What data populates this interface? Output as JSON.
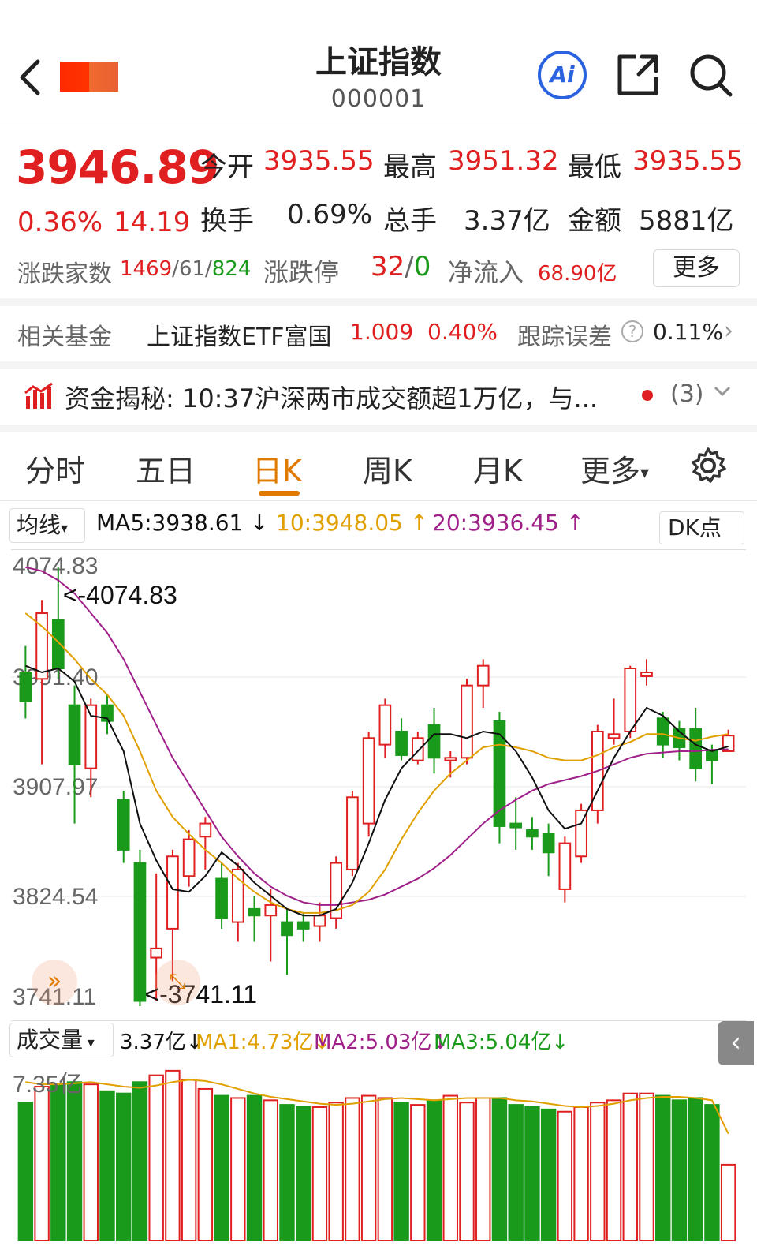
{
  "header": {
    "title": "上证指数",
    "code": "000001",
    "back_icon": "chevron-left-icon",
    "ai_label": "Ai",
    "share_icon": "share-icon",
    "search_icon": "search-icon"
  },
  "quote": {
    "price": "3946.89",
    "change_pct": "0.36%",
    "change_pts": "14.19",
    "open_label": "今开",
    "open": "3935.55",
    "high_label": "最高",
    "high": "3951.32",
    "low_label": "最低",
    "low": "3935.55",
    "turnover_label": "换手",
    "turnover": "0.69%",
    "volume_label": "总手",
    "volume": "3.37亿",
    "amount_label": "金额",
    "amount": "5881亿",
    "breadth_label": "涨跌家数",
    "breadth_up": "1469",
    "breadth_flat": "61",
    "breadth_down": "824",
    "limit_label": "涨跌停",
    "limit_up": "32",
    "limit_down": "0",
    "netflow_label": "净流入",
    "netflow": "68.90亿",
    "more_label": "更多"
  },
  "fund": {
    "label": "相关基金",
    "name": "上证指数ETF富国",
    "price": "1.009",
    "change": "0.40%",
    "tracking_label": "跟踪误差",
    "tracking": "0.11%"
  },
  "news": {
    "icon": "chart-icon",
    "text": "资金揭秘: 10:37沪深两市成交额超1万亿，与...",
    "count": "(3)"
  },
  "tabs": [
    "分时",
    "五日",
    "日K",
    "周K",
    "月K",
    "更多"
  ],
  "ma_bar": {
    "selector": "均线",
    "ma5": "MA5:3938.61",
    "ma10": "10:3948.05",
    "ma20": "20:3936.45",
    "dk_label": "DK点"
  },
  "vol_bar": {
    "selector": "成交量",
    "vol": "3.37亿",
    "ma1": "MA1:4.73亿",
    "ma2": "MA2:5.03亿",
    "ma3": "MA3:5.04亿"
  },
  "colors": {
    "up": "#e02020",
    "down": "#1a9a1a",
    "ma5": "#111111",
    "ma10": "#e0a000",
    "ma20": "#a0208a",
    "accent": "#e07a00"
  },
  "chart_data": {
    "type": "candlestick",
    "y_ticks": [
      "4074.83",
      "3991.40",
      "3907.97",
      "3824.54",
      "3741.11"
    ],
    "ylim": [
      3741.11,
      4074.83
    ],
    "high_label": "<-4074.83",
    "low_label": "<-3741.11",
    "candles": [
      {
        "o": 3995,
        "c": 3973,
        "h": 4015,
        "l": 3960
      },
      {
        "o": 3990,
        "c": 4040,
        "h": 4050,
        "l": 3925
      },
      {
        "o": 4035,
        "c": 3998,
        "h": 4074.83,
        "l": 3990
      },
      {
        "o": 3970,
        "c": 3925,
        "h": 3985,
        "l": 3880
      },
      {
        "o": 3922,
        "c": 3970,
        "h": 3975,
        "l": 3900
      },
      {
        "o": 3970,
        "c": 3958,
        "h": 3978,
        "l": 3948
      },
      {
        "o": 3898,
        "c": 3860,
        "h": 3905,
        "l": 3850
      },
      {
        "o": 3850,
        "c": 3745,
        "h": 3860,
        "l": 3741.11
      },
      {
        "o": 3778,
        "c": 3785,
        "h": 3842,
        "l": 3745
      },
      {
        "o": 3800,
        "c": 3855,
        "h": 3860,
        "l": 3760
      },
      {
        "o": 3840,
        "c": 3868,
        "h": 3875,
        "l": 3832
      },
      {
        "o": 3870,
        "c": 3880,
        "h": 3885,
        "l": 3845
      },
      {
        "o": 3838,
        "c": 3808,
        "h": 3850,
        "l": 3800
      },
      {
        "o": 3805,
        "c": 3845,
        "h": 3850,
        "l": 3790
      },
      {
        "o": 3815,
        "c": 3810,
        "h": 3825,
        "l": 3790
      },
      {
        "o": 3810,
        "c": 3818,
        "h": 3830,
        "l": 3775
      },
      {
        "o": 3805,
        "c": 3795,
        "h": 3815,
        "l": 3765
      },
      {
        "o": 3805,
        "c": 3800,
        "h": 3812,
        "l": 3790
      },
      {
        "o": 3802,
        "c": 3810,
        "h": 3820,
        "l": 3790
      },
      {
        "o": 3808,
        "c": 3850,
        "h": 3855,
        "l": 3800
      },
      {
        "o": 3845,
        "c": 3900,
        "h": 3905,
        "l": 3840
      },
      {
        "o": 3880,
        "c": 3945,
        "h": 3950,
        "l": 3870
      },
      {
        "o": 3940,
        "c": 3970,
        "h": 3975,
        "l": 3930
      },
      {
        "o": 3950,
        "c": 3932,
        "h": 3960,
        "l": 3928
      },
      {
        "o": 3928,
        "c": 3945,
        "h": 3950,
        "l": 3925
      },
      {
        "o": 3955,
        "c": 3930,
        "h": 3968,
        "l": 3918
      },
      {
        "o": 3928,
        "c": 3930,
        "h": 3935,
        "l": 3915
      },
      {
        "o": 3930,
        "c": 3985,
        "h": 3990,
        "l": 3925
      },
      {
        "o": 3985,
        "c": 4000,
        "h": 4005,
        "l": 3968
      },
      {
        "o": 3958,
        "c": 3878,
        "h": 3965,
        "l": 3865
      },
      {
        "o": 3880,
        "c": 3877,
        "h": 3900,
        "l": 3860
      },
      {
        "o": 3875,
        "c": 3870,
        "h": 3885,
        "l": 3860
      },
      {
        "o": 3872,
        "c": 3858,
        "h": 3880,
        "l": 3840
      },
      {
        "o": 3830,
        "c": 3865,
        "h": 3870,
        "l": 3820
      },
      {
        "o": 3855,
        "c": 3890,
        "h": 3895,
        "l": 3850
      },
      {
        "o": 3890,
        "c": 3950,
        "h": 3955,
        "l": 3880
      },
      {
        "o": 3945,
        "c": 3948,
        "h": 3975,
        "l": 3940
      },
      {
        "o": 3950,
        "c": 3998,
        "h": 4000,
        "l": 3945
      },
      {
        "o": 3992,
        "c": 3995,
        "h": 4005,
        "l": 3985
      },
      {
        "o": 3960,
        "c": 3940,
        "h": 3965,
        "l": 3930
      },
      {
        "o": 3952,
        "c": 3938,
        "h": 3958,
        "l": 3928
      },
      {
        "o": 3952,
        "c": 3922,
        "h": 3968,
        "l": 3912
      },
      {
        "o": 3935,
        "c": 3928,
        "h": 3940,
        "l": 3910
      },
      {
        "o": 3935,
        "c": 3946.89,
        "h": 3951.32,
        "l": 3935.55
      }
    ],
    "ma5": [
      4000,
      3995,
      3998,
      3988,
      3962,
      3960,
      3935,
      3880,
      3852,
      3830,
      3828,
      3840,
      3858,
      3848,
      3835,
      3825,
      3815,
      3810,
      3810,
      3815,
      3835,
      3865,
      3898,
      3922,
      3935,
      3948,
      3948,
      3945,
      3950,
      3948,
      3935,
      3915,
      3890,
      3876,
      3880,
      3905,
      3930,
      3950,
      3968,
      3962,
      3950,
      3940,
      3935,
      3938.61
    ],
    "ma10": [
      4040,
      4030,
      4018,
      4005,
      3990,
      3978,
      3962,
      3935,
      3905,
      3885,
      3872,
      3860,
      3850,
      3838,
      3828,
      3820,
      3815,
      3812,
      3812,
      3814,
      3818,
      3828,
      3845,
      3868,
      3888,
      3905,
      3918,
      3928,
      3938,
      3940,
      3938,
      3935,
      3930,
      3928,
      3928,
      3932,
      3938,
      3942,
      3948,
      3948,
      3945,
      3943,
      3946,
      3948.05
    ],
    "ma20": [
      4075,
      4072,
      4065,
      4055,
      4040,
      4025,
      4005,
      3980,
      3955,
      3930,
      3910,
      3890,
      3870,
      3855,
      3842,
      3832,
      3825,
      3820,
      3818,
      3818,
      3820,
      3822,
      3826,
      3832,
      3838,
      3846,
      3856,
      3868,
      3880,
      3890,
      3898,
      3905,
      3910,
      3913,
      3916,
      3920,
      3925,
      3930,
      3933,
      3934,
      3935,
      3935,
      3936,
      3936.45
    ],
    "volume": {
      "ytick": "7.35亿",
      "ymax": 7.6,
      "values": [
        6.1,
        6.8,
        6.9,
        7.0,
        6.9,
        6.6,
        6.5,
        7.0,
        7.3,
        7.5,
        7.1,
        6.7,
        6.4,
        6.3,
        6.4,
        6.2,
        6.0,
        5.9,
        5.9,
        6.1,
        6.3,
        6.4,
        6.3,
        6.1,
        6.0,
        6.2,
        6.4,
        6.1,
        6.3,
        6.3,
        6.0,
        5.9,
        5.8,
        5.7,
        5.9,
        6.1,
        6.2,
        6.5,
        6.5,
        6.4,
        6.2,
        6.3,
        6.0,
        3.37
      ],
      "ma1": [
        7.0,
        6.9,
        6.9,
        6.95,
        7.0,
        6.9,
        6.8,
        6.75,
        6.85,
        7.0,
        7.1,
        7.05,
        6.9,
        6.7,
        6.5,
        6.35,
        6.25,
        6.15,
        6.05,
        6.0,
        6.05,
        6.15,
        6.25,
        6.3,
        6.25,
        6.2,
        6.25,
        6.3,
        6.3,
        6.3,
        6.2,
        6.15,
        6.05,
        5.95,
        5.9,
        5.95,
        6.05,
        6.2,
        6.3,
        6.35,
        6.35,
        6.3,
        6.2,
        4.73
      ]
    }
  }
}
